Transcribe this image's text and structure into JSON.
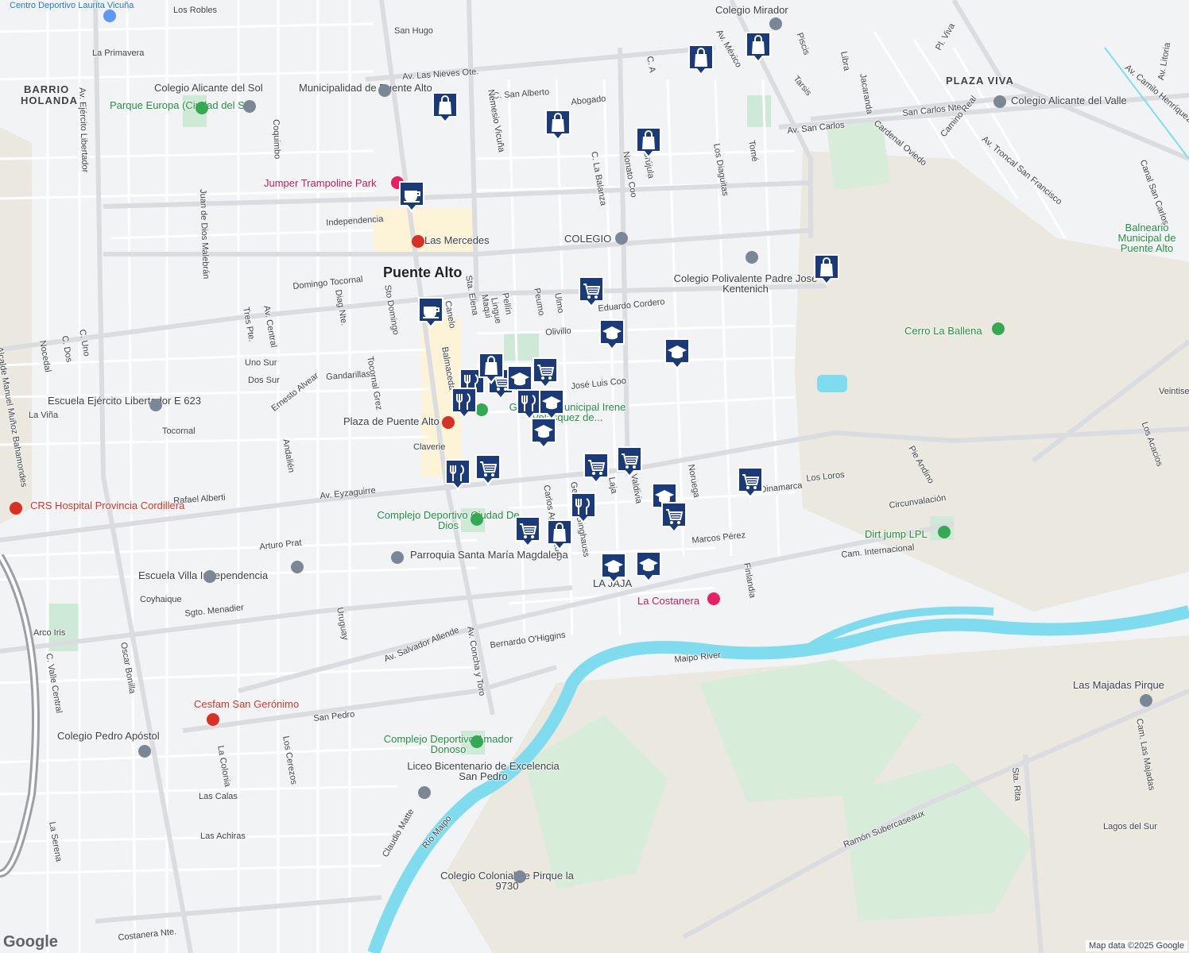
{
  "map": {
    "credit": "Map data ©2025 Google",
    "logo": "Google",
    "colors": {
      "background": "#f1f3f4",
      "road": "#ffffff",
      "arterial": "#dadce0",
      "green": "#ceead6",
      "water": "#7fdcee",
      "marker": "#1a3a7a"
    },
    "labels": {
      "city": "Puente Alto",
      "areas": [
        "BARRIO",
        "HOLANDA",
        "PLAZA VIVA"
      ],
      "streets": [
        "Los Robles",
        "San Hugo",
        "La Primavera",
        "Av. Las Nieves Ote.",
        "C. San Alberto",
        "Abogado",
        "Nemesio Vicuña",
        "Av. Ejército Libertador",
        "Coquimbo",
        "Juan de Dios Malebrán",
        "Independencia",
        "Domingo Tocornal",
        "Av. San Carlos",
        "San Carlos Nte.",
        "C. La Balanza",
        "Nonato Coo",
        "Brújula",
        "Los Diaguitas",
        "Tomé",
        "Eduardo Cordero",
        "Olivillo",
        "José Luis Coo",
        "Av. Eyzaguirre",
        "Circunvalación",
        "Cam. Internacional",
        "Marcos Pérez",
        "Av. Salvador Allende",
        "Av. Concha y Toro",
        "San Pedro",
        "Sgto. Menadier",
        "Ramón Subercaseaux",
        "Sta. Rita",
        "Maipo River",
        "Canal San Carlos",
        "Gandarillas",
        "Ernesto Alvear",
        "Tocornal",
        "Rafael Alberti",
        "Arturo Prat",
        "Coyhaique",
        "Bernardo O'Higgins",
        "Costanera Nte.",
        "Las Calas",
        "Las Achiras",
        "La Serena",
        "Nocedal",
        "Dos Sur",
        "Uno Sur",
        "Sto Domingo",
        "Canelo",
        "Sta. Elena",
        "Balmaceda",
        "Laja",
        "Valdivia",
        "Noruega",
        "Dinamarca",
        "Los Loros",
        "Finlandia",
        "Pie Andino",
        "Los Acacios",
        "Veintiseis",
        "Lagos del Sur",
        "Cam. Las Majadas",
        "Claudio Matte",
        "Río Maipo",
        "La Viña",
        "Uruguay",
        "Los Cerezos",
        "La Colonia",
        "Oscar Bonilla",
        "C. Valle Central",
        "Arco Iris",
        "Alcalde Manuel Muñoz Bahamondes",
        "Diag Nte.",
        "Tres Pte.",
        "Av. Central",
        "C. Uno",
        "C. Dos",
        "Pellín",
        "Maqui",
        "Peumo",
        "Ulmo",
        "Libra",
        "Tarsis",
        "Piscis",
        "Jacaranda",
        "Cardenal Oviedo",
        "Camino Real",
        "Av. Troncal San Francisco",
        "Av. Camilo Henríquez",
        "Av. México",
        "Pl. Viva",
        "C. A",
        "Tocornal Grez",
        "Andalién",
        "Claverie",
        "Carlos Aguirre Luco",
        "Gerardo Ginghauss",
        "Av. San Carlos",
        "Av. Litoria",
        "Lingue",
        "Nemesio Vicuña"
      ],
      "pois": [
        "Centro Deportivo Laurita Vicuña",
        "Colegio Alicante del Sol",
        "Parque Europa (Ciudad del Sol)",
        "Municipalidad de Puente Alto",
        "Jumper Trampoline Park",
        "Las Mercedes",
        "COLEGIO",
        "Colegio Polivalente Padre José Kentenich",
        "Colegio Mirador",
        "Colegio Alicante del Valle",
        "Balneario Municipal de Puente Alto",
        "Cerro La Ballena",
        "Escuela Ejército Libertador E 623",
        "Plaza de Puente Alto",
        "Gimnasio Municipal Irene Velásquez de...",
        "CRS Hospital Provincia Cordillera",
        "Complejo Deportivo Ciudad De Dios",
        "Parroquia Santa María Magdalena",
        "Escuela Villa Independencia",
        "Dirt jump LPL",
        "La Costanera",
        "LA JAJA",
        "Cesfam San Gerónimo",
        "Colegio Pedro Apóstol",
        "Complejo Deportivo Amador Donoso",
        "Liceo Bicentenario de Excelencia San Pedro",
        "Colegio Colonial de Pirque la 9730",
        "Las Majadas Pirque"
      ]
    },
    "markers": [
      {
        "type": "shopping-bag"
      },
      {
        "type": "shopping-bag"
      },
      {
        "type": "shopping-bag"
      },
      {
        "type": "shopping-bag"
      },
      {
        "type": "shopping-bag"
      },
      {
        "type": "coffee"
      },
      {
        "type": "coffee"
      },
      {
        "type": "shopping-bag"
      },
      {
        "type": "shopping-cart"
      },
      {
        "type": "school"
      },
      {
        "type": "school"
      },
      {
        "type": "restaurant"
      },
      {
        "type": "shopping-cart"
      },
      {
        "type": "school"
      },
      {
        "type": "restaurant"
      },
      {
        "type": "restaurant"
      },
      {
        "type": "school"
      },
      {
        "type": "school"
      },
      {
        "type": "shopping-cart"
      },
      {
        "type": "restaurant"
      },
      {
        "type": "shopping-cart"
      },
      {
        "type": "shopping-cart"
      },
      {
        "type": "shopping-cart"
      },
      {
        "type": "shopping-cart"
      },
      {
        "type": "restaurant"
      },
      {
        "type": "shopping-bag"
      },
      {
        "type": "shopping-cart"
      },
      {
        "type": "school"
      },
      {
        "type": "shopping-cart"
      },
      {
        "type": "school"
      },
      {
        "type": "school"
      },
      {
        "type": "shopping-bag"
      }
    ]
  }
}
